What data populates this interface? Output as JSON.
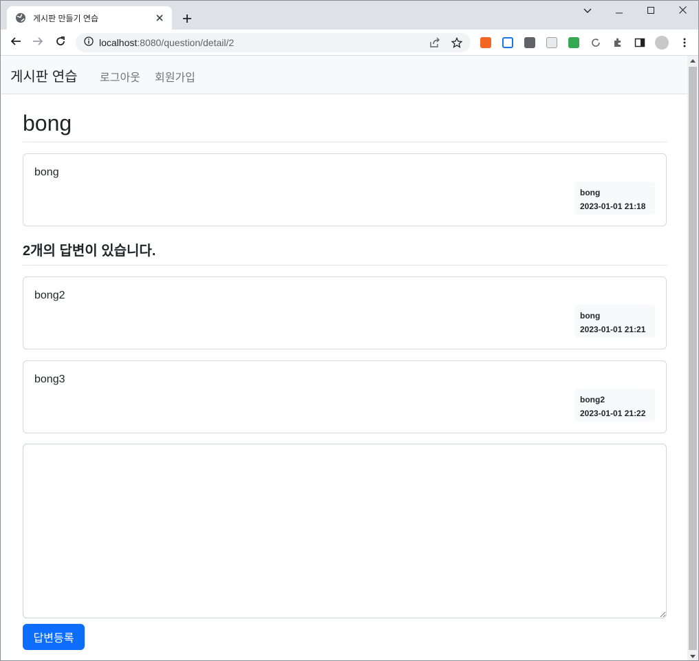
{
  "browser": {
    "tab_title": "게시판 만들기 연습",
    "new_tab": "+",
    "url_host": "localhost",
    "url_path": ":8080/question/detail/2"
  },
  "site": {
    "brand": "게시판 연습",
    "nav_links": [
      "로그아웃",
      "회원가입"
    ]
  },
  "question": {
    "subject": "bong",
    "content": "bong",
    "author": "bong",
    "date": "2023-01-01 21:18"
  },
  "answers_heading": "2개의 답변이 있습니다.",
  "answers": [
    {
      "content": "bong2",
      "author": "bong",
      "date": "2023-01-01 21:21"
    },
    {
      "content": "bong3",
      "author": "bong2",
      "date": "2023-01-01 21:22"
    }
  ],
  "answer_form": {
    "textarea_value": "",
    "submit_label": "답변등록"
  },
  "colors": {
    "primary": "#0d6efd",
    "navbar_bg": "#f8f9fa",
    "tabstrip_bg": "#dee1e6"
  }
}
